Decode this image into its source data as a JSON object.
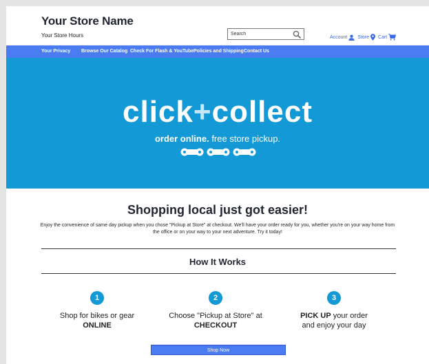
{
  "header": {
    "store_name": "Your Store Name",
    "store_hours": "Your Store Hours",
    "search": {
      "placeholder": "Search",
      "icon": "search-icon"
    },
    "links": [
      {
        "label": "Account",
        "icon": "user-icon"
      },
      {
        "label": "Store",
        "icon": "map-pin-icon"
      },
      {
        "label": "Cart",
        "icon": "cart-icon"
      }
    ]
  },
  "nav": {
    "items": [
      "Your Privacy",
      "Browse Our Catalog",
      "Check For Flash & YouTube",
      "Policies and Shipping",
      "Contact Us"
    ]
  },
  "hero": {
    "title_left": "click",
    "title_plus": "+",
    "title_right": "collect",
    "subtitle_bold": "order online.",
    "subtitle_rest": " free store pickup.",
    "background_color": "#139ad6"
  },
  "main": {
    "headline": "Shopping local just got easier!",
    "description": "Enjoy the convenience of same day pickup when you chose \"Pickup at Store\" at checkout. We'll have your order ready for you, whether you're on your way home from the office or on your way to your next adventure. Try it today!",
    "how_title": "How It Works",
    "steps": [
      {
        "number": "1",
        "line1": "Shop for bikes or gear",
        "line2": "ONLINE"
      },
      {
        "number": "2",
        "line1": "Choose \"Pickup at Store\" at",
        "line2": "CHECKOUT"
      },
      {
        "number": "3",
        "bold": "PICK UP",
        "line1_rest": " your order",
        "line2": "and enjoy your day"
      }
    ],
    "shop_button": "Shop Now"
  },
  "colors": {
    "nav": "#4a7bf0",
    "accent": "#139ad6",
    "link": "#3b67e8"
  }
}
